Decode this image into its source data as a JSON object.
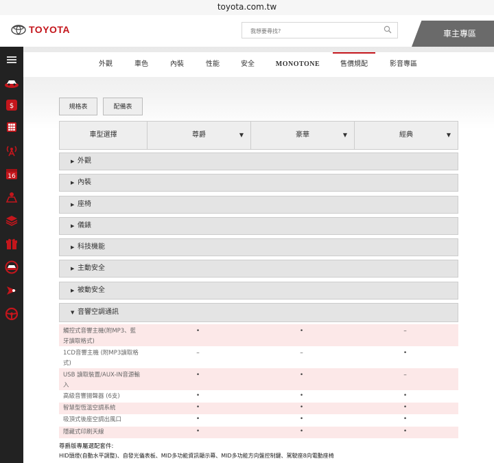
{
  "browser": {
    "url": "toyota.com.tw"
  },
  "header": {
    "brand": "TOYOTA",
    "search_placeholder": "我想要尋找?",
    "owner_label": "車主專區"
  },
  "sidebar": {
    "icons": [
      "menu-icon",
      "car-icon",
      "price-icon",
      "calculator-icon",
      "antenna-icon",
      "calendar-icon",
      "map-icon",
      "layers-icon",
      "gift-icon",
      "car-circle-icon",
      "navigation-icon",
      "steering-wheel-icon"
    ],
    "calendar_day": "16",
    "price_glyph": "$"
  },
  "nav": {
    "items": [
      "外觀",
      "車色",
      "內裝",
      "性能",
      "安全",
      "MONOTONE",
      "售價規配",
      "影音專區"
    ],
    "active_index": 6
  },
  "buttons": {
    "spec": "規格表",
    "equipment": "配備表"
  },
  "selector": {
    "label": "車型選擇",
    "models": [
      "尊爵",
      "豪華",
      "經典"
    ]
  },
  "accordion": [
    {
      "label": "外觀",
      "expanded": false
    },
    {
      "label": "內裝",
      "expanded": false
    },
    {
      "label": "座椅",
      "expanded": false
    },
    {
      "label": "儀錶",
      "expanded": false
    },
    {
      "label": "科技機能",
      "expanded": false
    },
    {
      "label": "主動安全",
      "expanded": false
    },
    {
      "label": "被動安全",
      "expanded": false
    },
    {
      "label": "音響空調通訊",
      "expanded": true
    }
  ],
  "audio_rows": [
    {
      "label": "觸控式音響主機(附MP3、藍牙讀取格式)",
      "values": [
        "•",
        "•",
        "–"
      ]
    },
    {
      "label": "1CD音響主機 (附MP3讀取格式)",
      "values": [
        "–",
        "–",
        "•"
      ]
    },
    {
      "label": "USB 讀取裝置/AUX-IN音源輸入",
      "values": [
        "•",
        "•",
        "–"
      ]
    },
    {
      "label": "高級音響揚聲器 (6支)",
      "values": [
        "•",
        "•",
        "•"
      ]
    },
    {
      "label": "智慧型恆溫空調系統",
      "values": [
        "•",
        "•",
        "•"
      ]
    },
    {
      "label": "吸頂式後座空調出風口",
      "values": [
        "•",
        "•",
        "•"
      ]
    },
    {
      "label": "隱藏式印刷天線",
      "values": [
        "•",
        "•",
        "•"
      ]
    }
  ],
  "note": {
    "title": "尊爵版專屬選配套件:",
    "text": "HID頭燈(自動水平調整)、自發光儀表板、MID多功能資訊顯示幕、MID多功能方向盤控制鍵、駕駛座8向電動座椅"
  },
  "colors": {
    "brand_red": "#c4161c",
    "sidebar_bg": "#222222",
    "row_pink": "#fce8e8"
  }
}
